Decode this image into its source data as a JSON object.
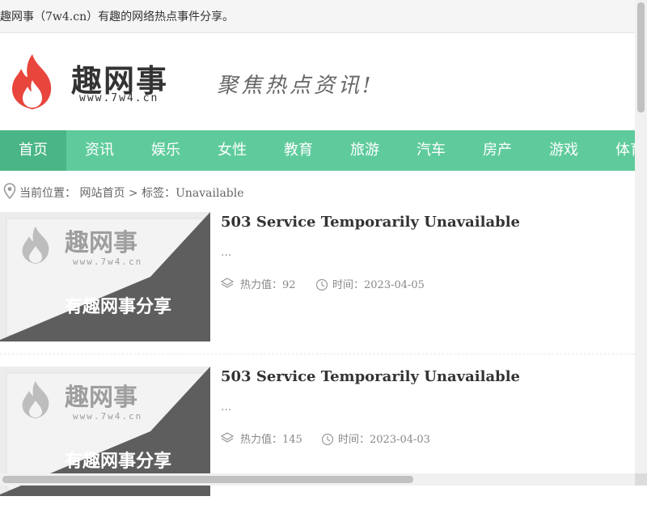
{
  "topbar": {
    "text": "趣网事（7w4.cn）有趣的网络热点事件分享。"
  },
  "header": {
    "logo_title": "趣网事",
    "logo_sub": "www.7w4.cn",
    "slogan": "聚焦热点资讯!"
  },
  "nav": {
    "items": [
      {
        "label": "首页"
      },
      {
        "label": "资讯"
      },
      {
        "label": "娱乐"
      },
      {
        "label": "女性"
      },
      {
        "label": "教育"
      },
      {
        "label": "旅游"
      },
      {
        "label": "汽车"
      },
      {
        "label": "房产"
      },
      {
        "label": "游戏"
      },
      {
        "label": "体育"
      }
    ]
  },
  "breadcrumb": {
    "text": "当前位置： 网站首页 > 标签：Unavailable"
  },
  "thumbnail": {
    "brand": "趣网事",
    "url": "www.7w4.cn",
    "caption": "有趣网事分享"
  },
  "articles": [
    {
      "title": "503 Service Temporarily Unavailable",
      "excerpt": "...",
      "heat_label": "热力值：92",
      "time_label": "时间：2023-04-05"
    },
    {
      "title": "503 Service Temporarily Unavailable",
      "excerpt": "...",
      "heat_label": "热力值：145",
      "time_label": "时间：2023-04-03"
    }
  ],
  "colors": {
    "nav_bg": "#5fcb9c",
    "nav_active": "#4ab586",
    "flame_red": "#e8453c"
  }
}
